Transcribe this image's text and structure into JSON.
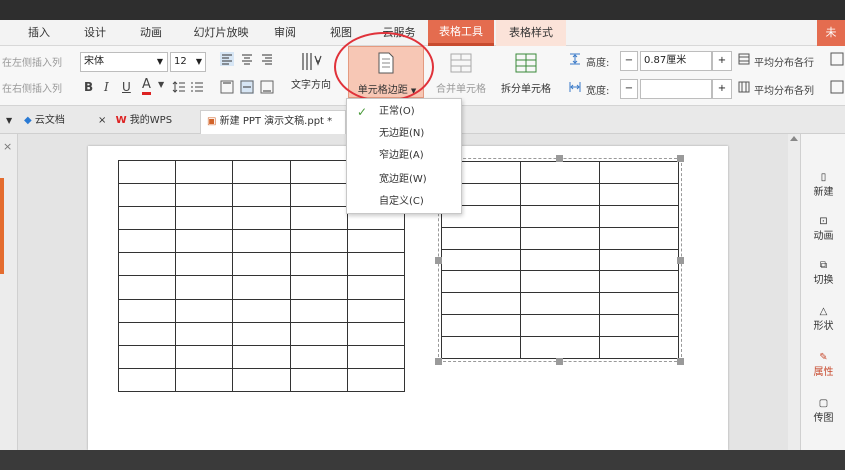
{
  "menubar": {
    "tabs": [
      "插入",
      "设计",
      "动画",
      "幻灯片放映",
      "审阅",
      "视图",
      "云服务"
    ],
    "context_tabs": [
      "表格工具",
      "表格样式"
    ],
    "right_label": "未"
  },
  "ribbon": {
    "insert_left": "在左侧插入列",
    "insert_right": "在右侧插入列",
    "font_name": "宋体",
    "font_size": "12",
    "bold": "B",
    "italic": "I",
    "underline": "U",
    "font_color": "A",
    "text_direction": "文字方向",
    "cell_margin": "单元格边距",
    "merge_cells": "合并单元格",
    "split_cells": "拆分单元格",
    "height_label": "高度:",
    "height_value": "0.87厘米",
    "width_label": "宽度:",
    "width_value": "",
    "minus": "−",
    "plus": "+",
    "distribute_rows": "平均分布各行",
    "distribute_cols": "平均分布各列"
  },
  "tabs": {
    "items": [
      {
        "label": "云文档"
      },
      {
        "label": "我的WPS"
      },
      {
        "label": "新建 PPT 演示文稿.ppt *"
      }
    ],
    "close": "×"
  },
  "dropdown": {
    "items": [
      "正常(O)",
      "无边距(N)",
      "窄边距(A)",
      "宽边距(W)",
      "自定义(C)"
    ],
    "checked_index": 0,
    "check": "✓"
  },
  "rightpane": {
    "items": [
      "新建",
      "动画",
      "切换",
      "形状",
      "属性",
      "传图"
    ]
  },
  "colors": {
    "accent": "#e46c4f",
    "highlight": "#f7c7b5",
    "annotation": "#e0323a"
  }
}
